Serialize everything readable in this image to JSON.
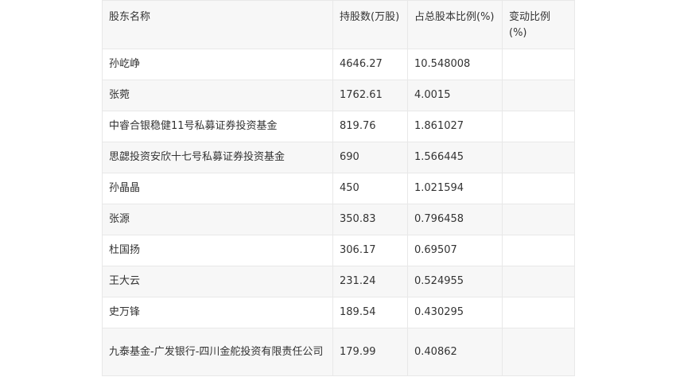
{
  "table": {
    "headers": [
      "股东名称",
      "持股数(万股)",
      "占总股本比例(%)",
      "变动比例(%)"
    ],
    "rows": [
      [
        "孙屹峥",
        "4646.27",
        "10.548008",
        ""
      ],
      [
        "张菀",
        "1762.61",
        "4.0015",
        ""
      ],
      [
        "中睿合银稳健11号私募证券投资基金",
        "819.76",
        "1.861027",
        ""
      ],
      [
        "思勰投资安欣十七号私募证券投资基金",
        "690",
        "1.566445",
        ""
      ],
      [
        "孙晶晶",
        "450",
        "1.021594",
        ""
      ],
      [
        "张源",
        "350.83",
        "0.796458",
        ""
      ],
      [
        "杜国扬",
        "306.17",
        "0.69507",
        ""
      ],
      [
        "王大云",
        "231.24",
        "0.524955",
        ""
      ],
      [
        "史万锋",
        "189.54",
        "0.430295",
        ""
      ],
      [
        "九泰基金-广发银行-四川金舵投资有限责任公司",
        "179.99",
        "0.40862",
        ""
      ]
    ]
  }
}
